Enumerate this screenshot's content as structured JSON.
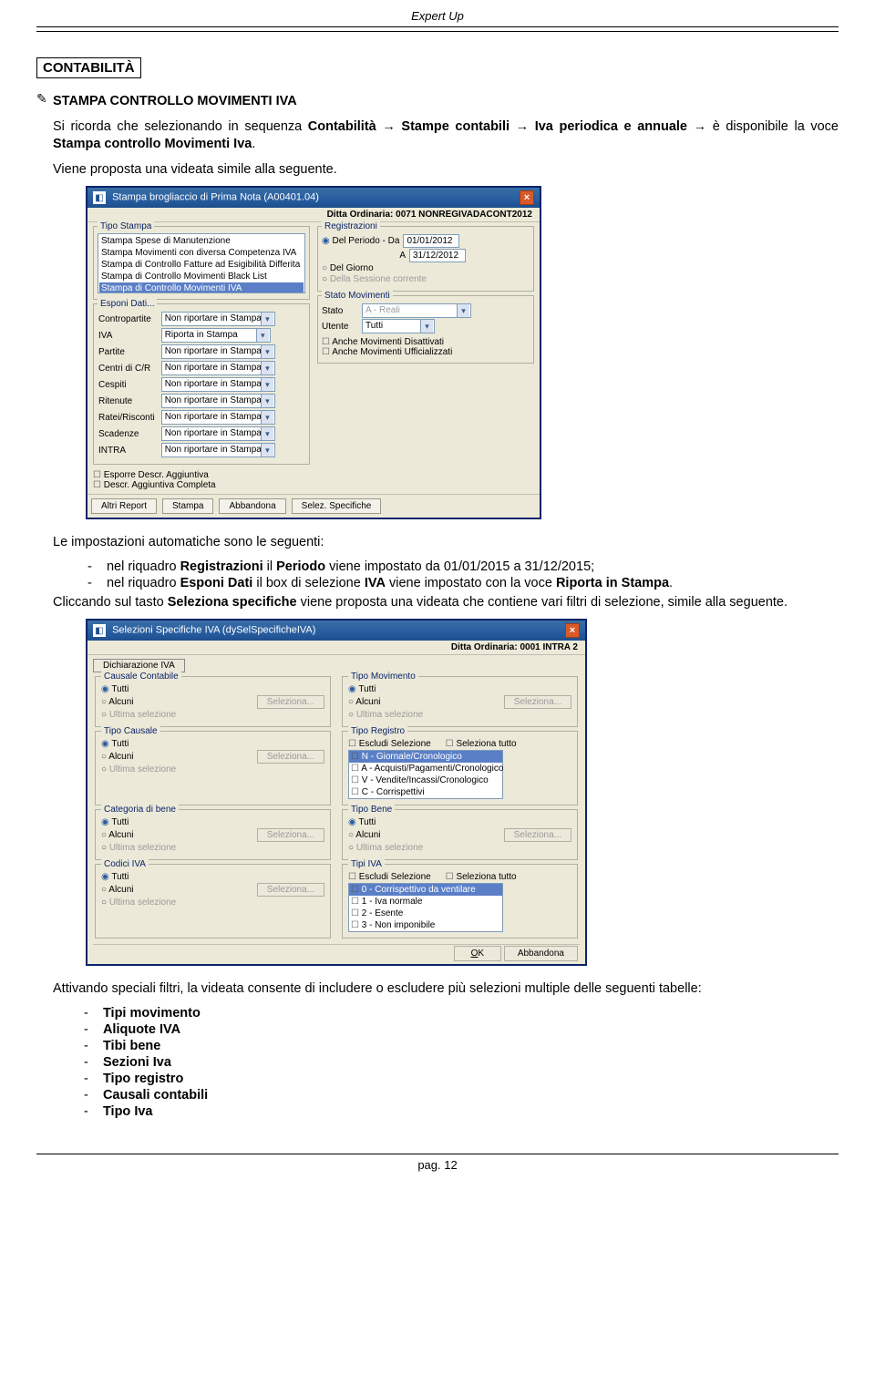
{
  "doc": {
    "header": "Expert Up",
    "section_title": "CONTABILITÀ",
    "hand": "✎",
    "h2": "STAMPA CONTROLLO MOVIMENTI IVA",
    "para1": "Si ricorda che selezionando in sequenza Contabilità → Stampe contabili → Iva periodica e annuale → è disponibile la voce Stampa controllo Movimenti Iva.",
    "para1b": "Viene proposta una videata simile alla seguente.",
    "para2": "Le impostazioni automatiche sono le seguenti:",
    "bullets1": [
      "nel riquadro Registrazioni il Periodo viene impostato da 01/01/2015 a 31/12/2015;",
      "nel riquadro Esponi Dati il box di selezione IVA viene impostato con la voce Riporta in Stampa."
    ],
    "para3": "Cliccando sul tasto Seleziona specifiche viene proposta una videata che contiene vari filtri di selezione, simile alla seguente.",
    "para4": "Attivando speciali filtri, la videata consente di includere o escludere più selezioni multiple delle seguenti tabelle:",
    "tables_list": [
      "Tipi movimento",
      "Aliquote IVA",
      "Tibi bene",
      "Sezioni Iva",
      "Tipo registro",
      "Causali contabili",
      "Tipo Iva"
    ],
    "page_footer": "pag. 12"
  },
  "fig1": {
    "title": "Stampa brogliaccio di Prima Nota   (A00401.04)",
    "subtitle": "Ditta Ordinaria: 0071 NONREGIVADACONT2012",
    "grp_tipo": "Tipo Stampa",
    "tipo_items": [
      "Stampa Spese di Manutenzione",
      "Stampa Movimenti con diversa Competenza IVA",
      "Stampa di Controllo Fatture ad Esigibilità Differita",
      "Stampa di Controllo Movimenti Black List",
      "Stampa di Controllo Movimenti IVA"
    ],
    "grp_reg": "Registrazioni",
    "reg_periodo": "Del Periodo - Da",
    "reg_A": "A",
    "reg_date_from": "01/01/2012",
    "reg_date_to": "31/12/2012",
    "reg_giorno": "Del Giorno",
    "reg_sessione": "Della Sessione corrente",
    "grp_esponi": "Esponi Dati...",
    "esponi_labels": [
      "Contropartite",
      "IVA",
      "Partite",
      "Centri di C/R",
      "Cespiti",
      "Ritenute",
      "Ratei/Risconti",
      "Scadenze",
      "INTRA"
    ],
    "esponi_vals": [
      "Non riportare in Stampa",
      "Riporta in Stampa",
      "Non riportare in Stampa",
      "Non riportare in Stampa",
      "Non riportare in Stampa",
      "Non riportare in Stampa",
      "Non riportare in Stampa",
      "Non riportare in Stampa",
      "Non riportare in Stampa"
    ],
    "grp_stato": "Stato Movimenti",
    "stato_lbl": "Stato",
    "stato_val": "A - Reali",
    "utente_lbl": "Utente",
    "utente_val": "Tutti",
    "chk_disatt": "Anche Movimenti Disattivati",
    "chk_uffic": "Anche Movimenti Ufficializzati",
    "chk_agg": "Esporre Descr. Aggiuntiva",
    "chk_aggcomp": "Descr. Aggiuntiva Completa",
    "buttons": [
      "Altri Report",
      "Stampa",
      "Abbandona",
      "Selez. Specifiche"
    ]
  },
  "fig2": {
    "title": "Selezioni Specifiche IVA (dySelSpecificheIVA)",
    "subtitle": "Ditta Ordinaria: 0001 INTRA 2",
    "btn_dich": "Dichiarazione IVA",
    "groups": {
      "causale": "Causale Contabile",
      "tipomov": "Tipo Movimento",
      "tipocaus": "Tipo Causale",
      "tiporeg": "Tipo Registro",
      "catbene": "Categoria di bene",
      "tipobene": "Tipo Bene",
      "codiva": "Codici IVA",
      "tipiiva": "Tipi IVA"
    },
    "radio_tutti": "Tutti",
    "radio_alcuni": "Alcuni",
    "radio_ultima": "Ultima selezione",
    "btn_selez": "Seleziona...",
    "chk_escludi": "Escludi Selezione",
    "chk_seltutto": "Seleziona tutto",
    "tiporeg_items": [
      "N - Giornale/Cronologico",
      "A - Acquisti/Pagamenti/Cronologico",
      "V - Vendite/Incassi/Cronologico",
      "C - Corrispettivi"
    ],
    "tipiiva_items": [
      "0 - Corrispettivo da ventilare",
      "1 - Iva normale",
      "2 - Esente",
      "3 - Non imponibile"
    ],
    "btn_ok": "OK",
    "btn_abb": "Abbandona"
  }
}
